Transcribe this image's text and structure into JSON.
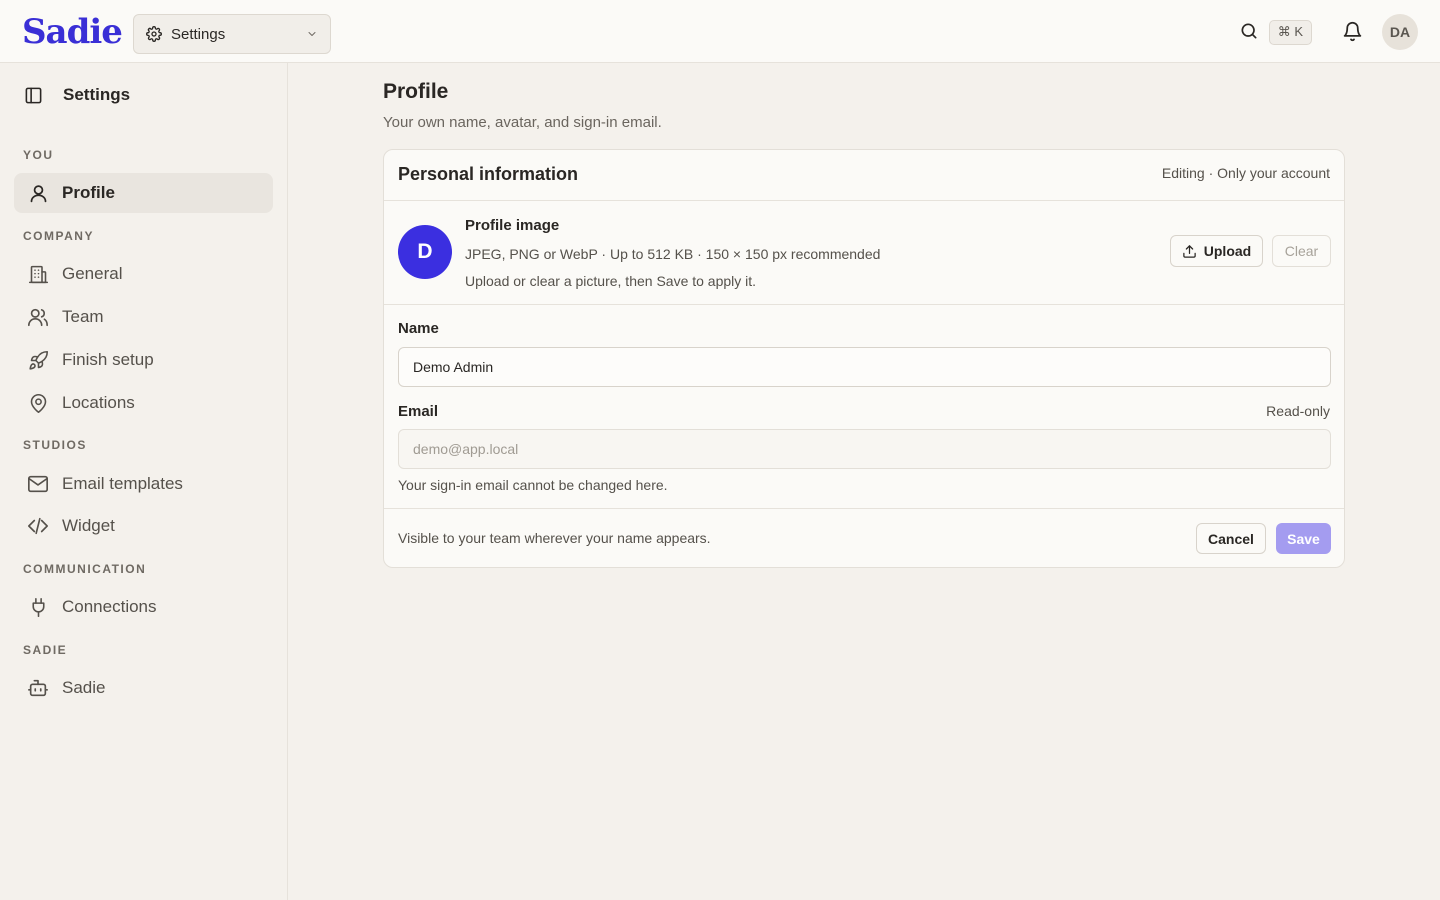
{
  "app": {
    "logo": "Sadie"
  },
  "header": {
    "switcher_label": "Settings",
    "shortcut": "⌘ K",
    "avatar_initials": "DA"
  },
  "sidebar": {
    "title": "Settings",
    "sections": [
      {
        "label": "YOU"
      },
      {
        "label": "COMPANY"
      },
      {
        "label": "STUDIOS"
      },
      {
        "label": "COMMUNICATION"
      },
      {
        "label": "SADIE"
      }
    ],
    "items": [
      {
        "label": "Profile",
        "icon": "user-icon",
        "active": true
      },
      {
        "label": "General",
        "icon": "building-icon"
      },
      {
        "label": "Team",
        "icon": "users-icon"
      },
      {
        "label": "Finish setup",
        "icon": "rocket-icon"
      },
      {
        "label": "Locations",
        "icon": "map-pin-icon"
      },
      {
        "label": "Email templates",
        "icon": "mail-icon"
      },
      {
        "label": "Widget",
        "icon": "code-icon"
      },
      {
        "label": "Connections",
        "icon": "plug-icon"
      },
      {
        "label": "Sadie",
        "icon": "bot-icon"
      }
    ]
  },
  "main": {
    "title": "Profile",
    "subtitle": "Your own name, avatar, and sign-in email.",
    "card": {
      "title": "Personal information",
      "meta": "Editing · Only your account",
      "image": {
        "initial": "D",
        "title": "Profile image",
        "description": "JPEG, PNG or WebP · Up to 512 KB · 150 × 150 px recommended",
        "hint": "Upload or clear a picture, then Save to apply it.",
        "upload_label": "Upload",
        "clear_label": "Clear"
      },
      "name": {
        "label": "Name",
        "value": "Demo Admin"
      },
      "email": {
        "label": "Email",
        "readonly_label": "Read-only",
        "placeholder": "demo@app.local",
        "help": "Your sign-in email cannot be changed here."
      },
      "footer": {
        "text": "Visible to your team wherever your name appears.",
        "cancel_label": "Cancel",
        "save_label": "Save"
      }
    }
  },
  "colors": {
    "brand": "#3a2fd6",
    "avatar": "#3b2fe0",
    "save_disabled": "#a49cf0",
    "background": "#f4f1ec"
  }
}
